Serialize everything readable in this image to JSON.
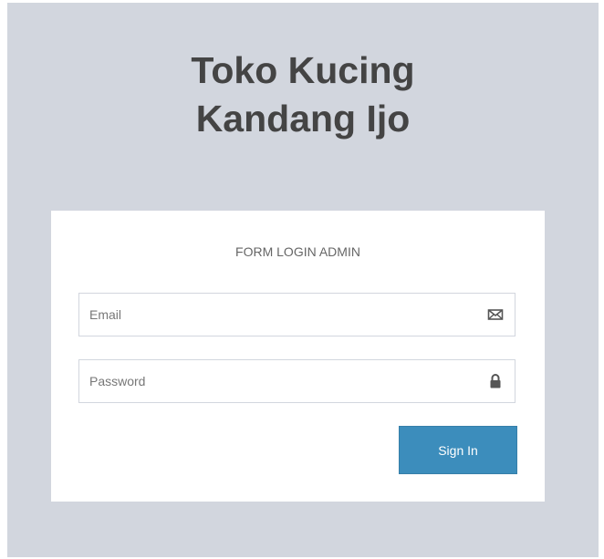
{
  "brand": {
    "line1": "Toko Kucing",
    "line2": "Kandang Ijo"
  },
  "login": {
    "message": "FORM LOGIN ADMIN",
    "email": {
      "placeholder": "Email",
      "value": "",
      "icon": "envelope-icon"
    },
    "password": {
      "placeholder": "Password",
      "value": "",
      "icon": "lock-icon"
    },
    "submit_label": "Sign In"
  },
  "colors": {
    "page_background": "#d2d6de",
    "box_background": "#ffffff",
    "primary_button": "#3c8dbc",
    "brand_text": "#444444"
  }
}
